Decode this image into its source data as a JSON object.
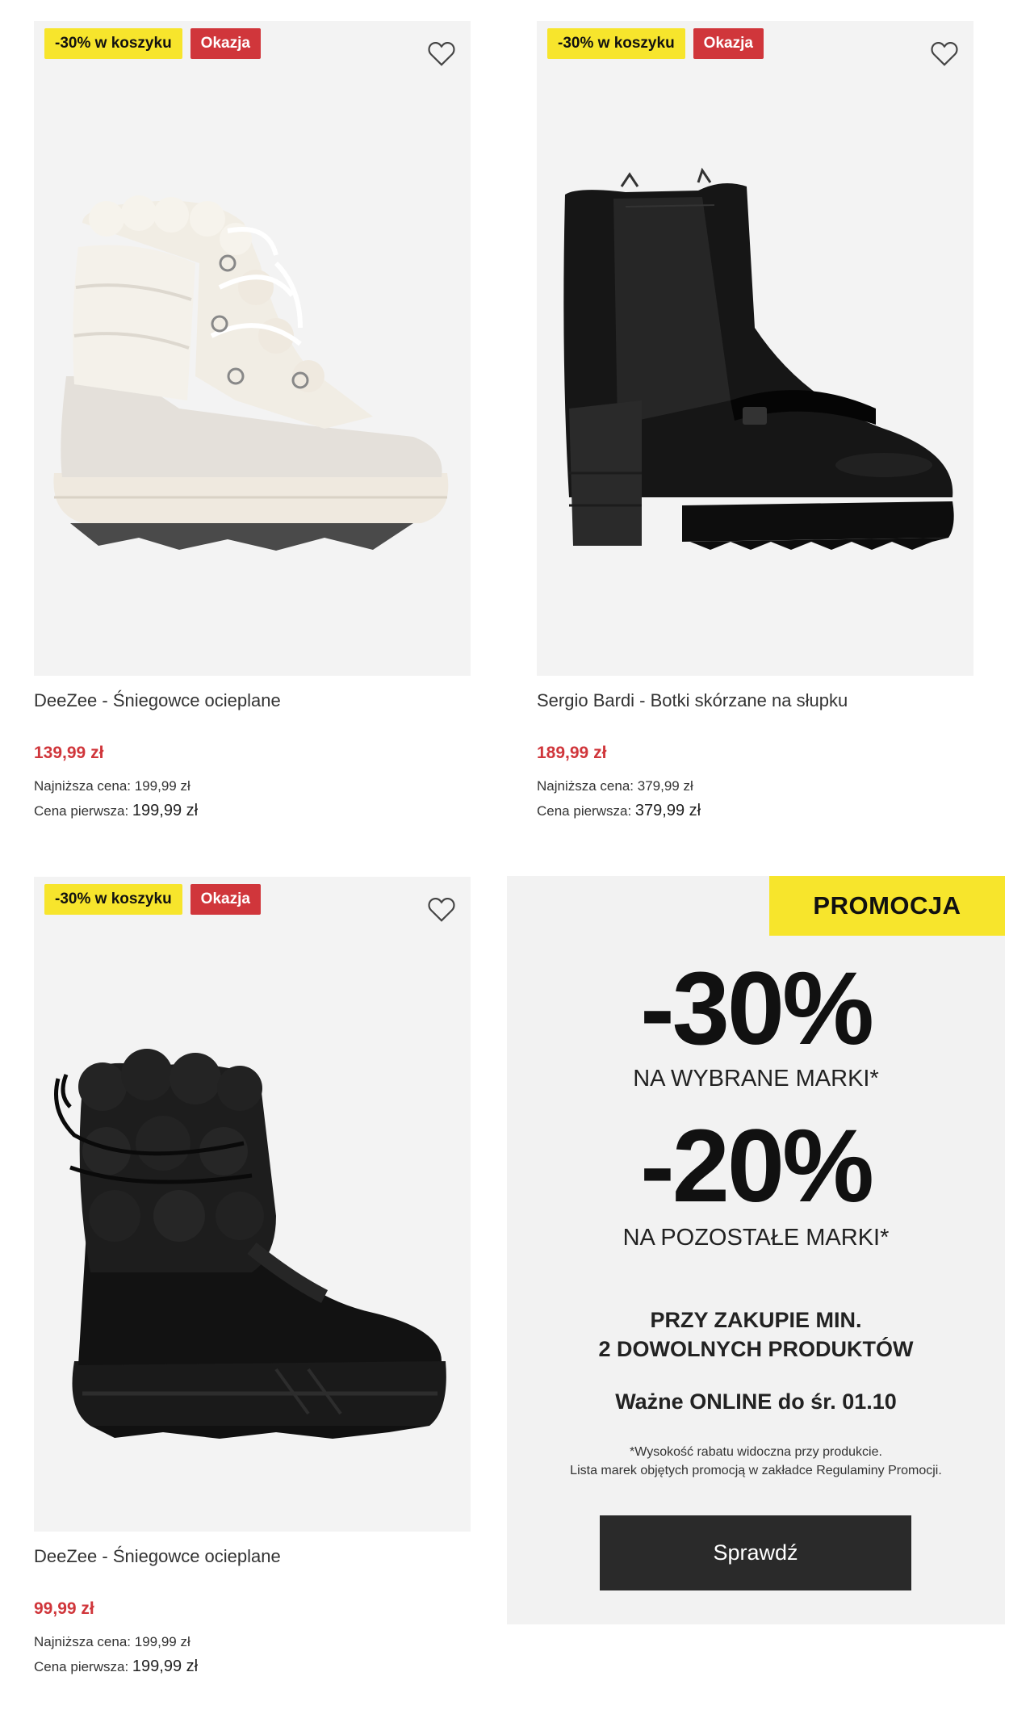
{
  "products": [
    {
      "badge_discount": "-30% w koszyku",
      "badge_sale": "Okazja",
      "name": "DeeZee - Śniegowce ocieplane",
      "price": "139,99 zł",
      "lowest_label": "Najniższa cena:",
      "lowest_value": "199,99 zł",
      "first_label": "Cena pierwsza:",
      "first_value": "199,99 zł"
    },
    {
      "badge_discount": "-30% w koszyku",
      "badge_sale": "Okazja",
      "name": "Sergio Bardi - Botki skórzane na słupku",
      "price": "189,99 zł",
      "lowest_label": "Najniższa cena:",
      "lowest_value": "379,99 zł",
      "first_label": "Cena pierwsza:",
      "first_value": "379,99 zł"
    },
    {
      "badge_discount": "-30% w koszyku",
      "badge_sale": "Okazja",
      "name": "DeeZee - Śniegowce ocieplane",
      "price": "99,99 zł",
      "lowest_label": "Najniższa cena:",
      "lowest_value": "199,99 zł",
      "first_label": "Cena pierwsza:",
      "first_value": "199,99 zł"
    }
  ],
  "promo": {
    "tag": "PROMOCJA",
    "big1": "-30%",
    "sub1": "NA WYBRANE MARKI*",
    "big2": "-20%",
    "sub2": "NA POZOSTAŁE MARKI*",
    "cond1": "PRZY ZAKUPIE MIN.",
    "cond2": "2 DOWOLNYCH PRODUKTÓW",
    "valid": "Ważne ONLINE do śr. 01.10",
    "note1": "*Wysokość rabatu widoczna przy produkcie.",
    "note2": "Lista marek objętych promocją w zakładce Regulaminy Promocji.",
    "cta": "Sprawdź"
  },
  "colors": {
    "sale_red": "#d0363b",
    "promo_yellow": "#f7e52c",
    "cta_dark": "#2a2a2a"
  },
  "icons": {
    "wishlist": "heart-icon"
  }
}
